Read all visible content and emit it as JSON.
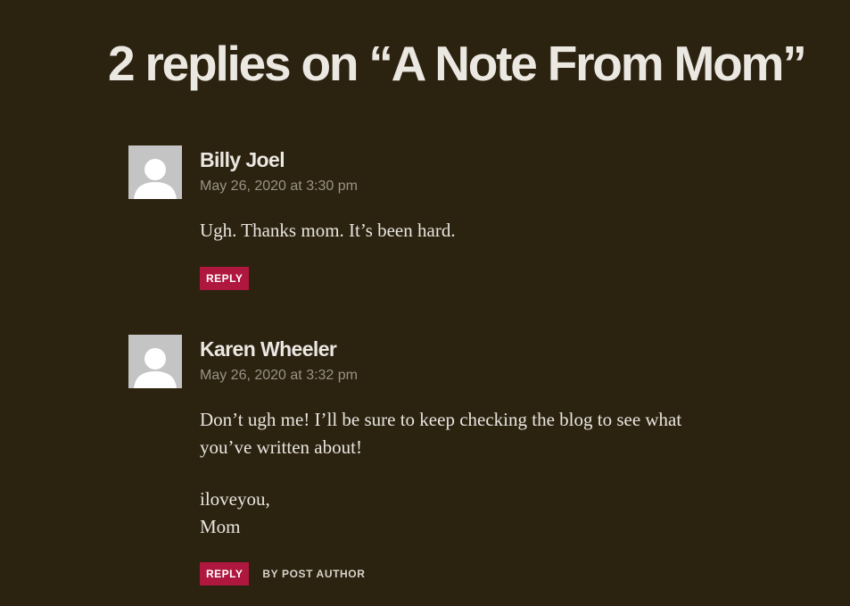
{
  "comments_title": "2 replies on “A Note From Mom”",
  "colors": {
    "background": "#2b2210",
    "reply_button": "#b0173f",
    "avatar": "#c4c4c4"
  },
  "comments": [
    {
      "avatar_icon": "default-user-avatar",
      "author": "Billy Joel",
      "date": "May 26, 2020 at 3:30 pm",
      "paragraphs": [
        "Ugh. Thanks mom. It’s been hard."
      ],
      "reply_label": "REPLY"
    },
    {
      "avatar_icon": "default-user-avatar",
      "author": "Karen Wheeler",
      "date": "May 26, 2020 at 3:32 pm",
      "paragraphs": [
        "Don’t ugh me! I’ll be sure to keep checking the blog to see what you’ve written about!"
      ],
      "signoff_line1": "iloveyou,",
      "signoff_line2": "Mom",
      "reply_label": "REPLY",
      "badge": "BY POST AUTHOR"
    }
  ]
}
